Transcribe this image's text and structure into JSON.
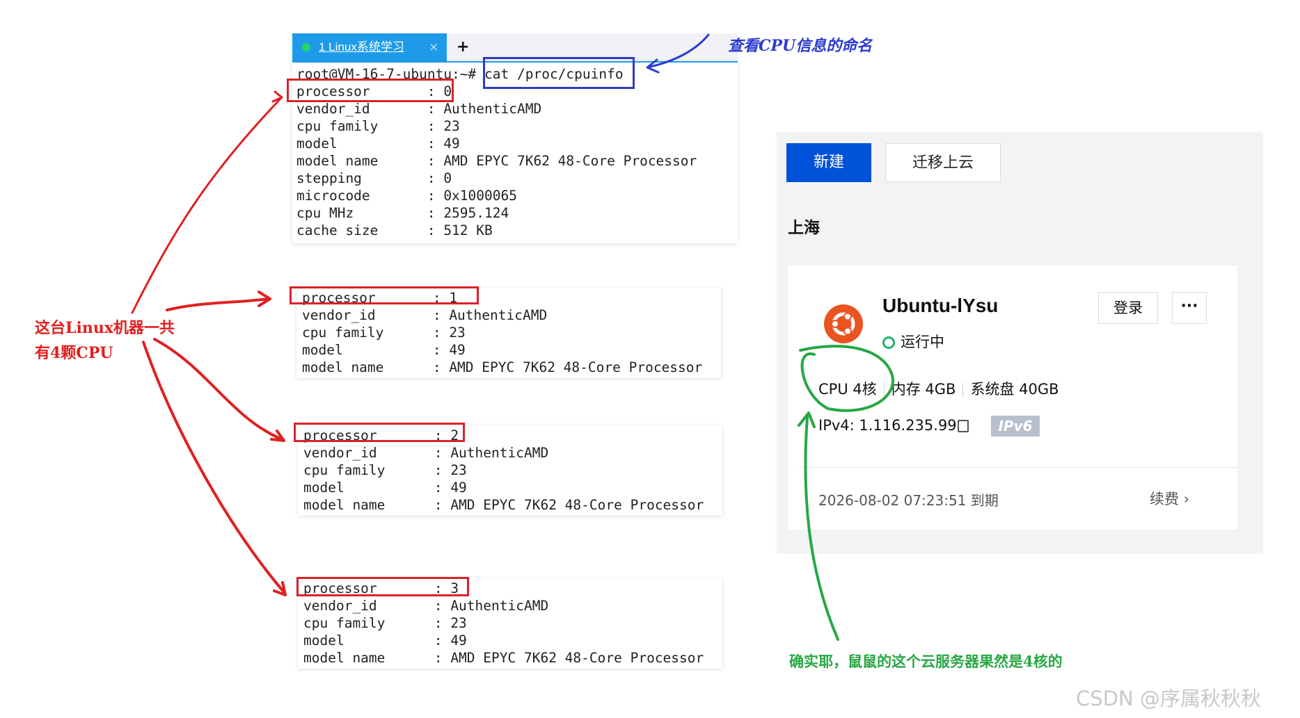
{
  "terminal": {
    "tab_label": "1 Linux系统学习",
    "tab_close": "×",
    "new_tab": "+",
    "prompt": "root@VM-16-7-ubuntu:~#",
    "command": "cat /proc/cpuinfo",
    "lines": [
      "processor       : 0",
      "vendor_id       : AuthenticAMD",
      "cpu family      : 23",
      "model           : 49",
      "model name      : AMD EPYC 7K62 48-Core Processor",
      "stepping        : 0",
      "microcode       : 0x1000065",
      "cpu MHz         : 2595.124",
      "cache size      : 512 KB"
    ]
  },
  "blocks": [
    {
      "lines": [
        "processor       : 1",
        "vendor_id       : AuthenticAMD",
        "cpu family      : 23",
        "model           : 49",
        "model name      : AMD EPYC 7K62 48-Core Processor"
      ]
    },
    {
      "lines": [
        "processor       : 2",
        "vendor_id       : AuthenticAMD",
        "cpu family      : 23",
        "model           : 49",
        "model name      : AMD EPYC 7K62 48-Core Processor"
      ]
    },
    {
      "lines": [
        "processor       : 3",
        "vendor_id       : AuthenticAMD",
        "cpu family      : 23",
        "model           : 49",
        "model name      : AMD EPYC 7K62 48-Core Processor"
      ]
    }
  ],
  "annotations": {
    "cmd_note": "查看CPU信息的命名",
    "left_note_1": "这台Linux机器一共",
    "left_note_2": "有4颗CPU",
    "green_note": "确实耶，鼠鼠的这个云服务器果然是4核的",
    "red": "#e02020",
    "blue": "#2b3bd0",
    "green": "#28a745"
  },
  "cloud": {
    "new_button": "新建",
    "migrate_button": "迁移上云",
    "region": "上海",
    "instance_name": "Ubuntu-lYsu",
    "status": "运行中",
    "login_button": "登录",
    "more_button": "···",
    "cpu": "CPU 4核",
    "memory": "内存 4GB",
    "disk": "系统盘 40GB",
    "ipv4": "IPv4: 1.116.235.99",
    "ipv6_badge": "IPv6",
    "expire": "2026-08-02 07:23:51 到期",
    "renew": "续费 ›",
    "accent": "#0052d9",
    "logo_color": "#e95420"
  },
  "watermark": "CSDN @序属秋秋秋"
}
